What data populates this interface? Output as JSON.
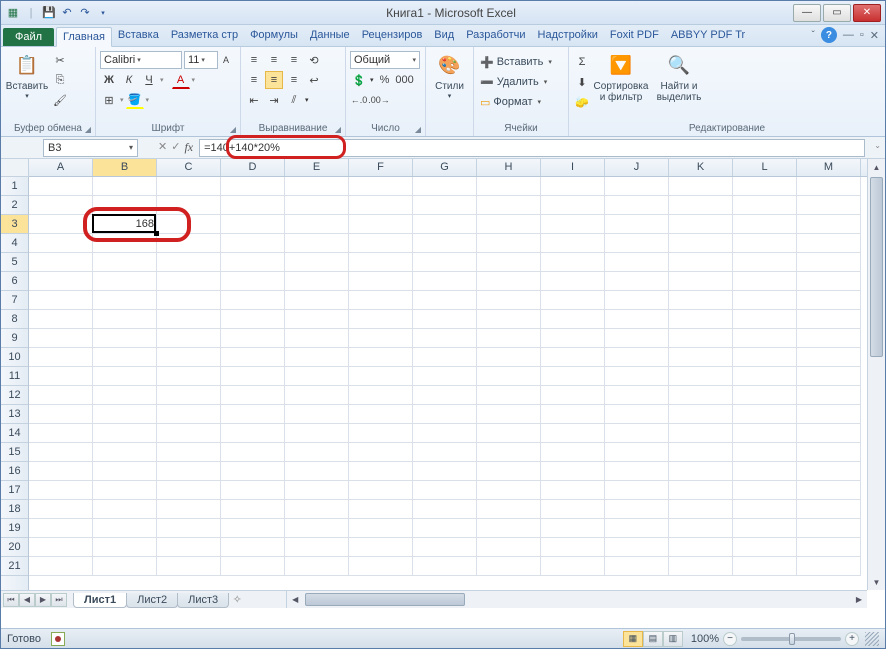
{
  "window": {
    "title": "Книга1 - Microsoft Excel"
  },
  "qat": {
    "save": "💾",
    "undo": "↶",
    "redo": "↷"
  },
  "tabs": {
    "file": "Файл",
    "list": [
      "Главная",
      "Вставка",
      "Разметка стр",
      "Формулы",
      "Данные",
      "Рецензиров",
      "Вид",
      "Разработчи",
      "Надстройки",
      "Foxit PDF",
      "ABBYY PDF Tr"
    ],
    "active_index": 0
  },
  "ribbon": {
    "clipboard": {
      "paste": "Вставить",
      "label": "Буфер обмена"
    },
    "font": {
      "name": "Calibri",
      "size": "11",
      "label": "Шрифт",
      "bold": "Ж",
      "italic": "К",
      "underline": "Ч"
    },
    "alignment": {
      "label": "Выравнивание"
    },
    "number": {
      "format": "Общий",
      "label": "Число"
    },
    "styles": {
      "styles_btn": "Стили"
    },
    "cells": {
      "insert": "Вставить",
      "delete": "Удалить",
      "format": "Формат",
      "label": "Ячейки"
    },
    "editing": {
      "sort": "Сортировка\nи фильтр",
      "find": "Найти и\nвыделить",
      "label": "Редактирование"
    }
  },
  "formula_bar": {
    "cell_ref": "B3",
    "formula": "=140+140*20%"
  },
  "grid": {
    "columns": [
      "A",
      "B",
      "C",
      "D",
      "E",
      "F",
      "G",
      "H",
      "I",
      "J",
      "K",
      "L",
      "M"
    ],
    "row_count": 21,
    "active": {
      "col": "B",
      "row": 3,
      "col_index": 1,
      "value": "168"
    }
  },
  "sheets": {
    "list": [
      "Лист1",
      "Лист2",
      "Лист3"
    ],
    "active_index": 0
  },
  "status": {
    "ready": "Готово",
    "zoom": "100%"
  }
}
